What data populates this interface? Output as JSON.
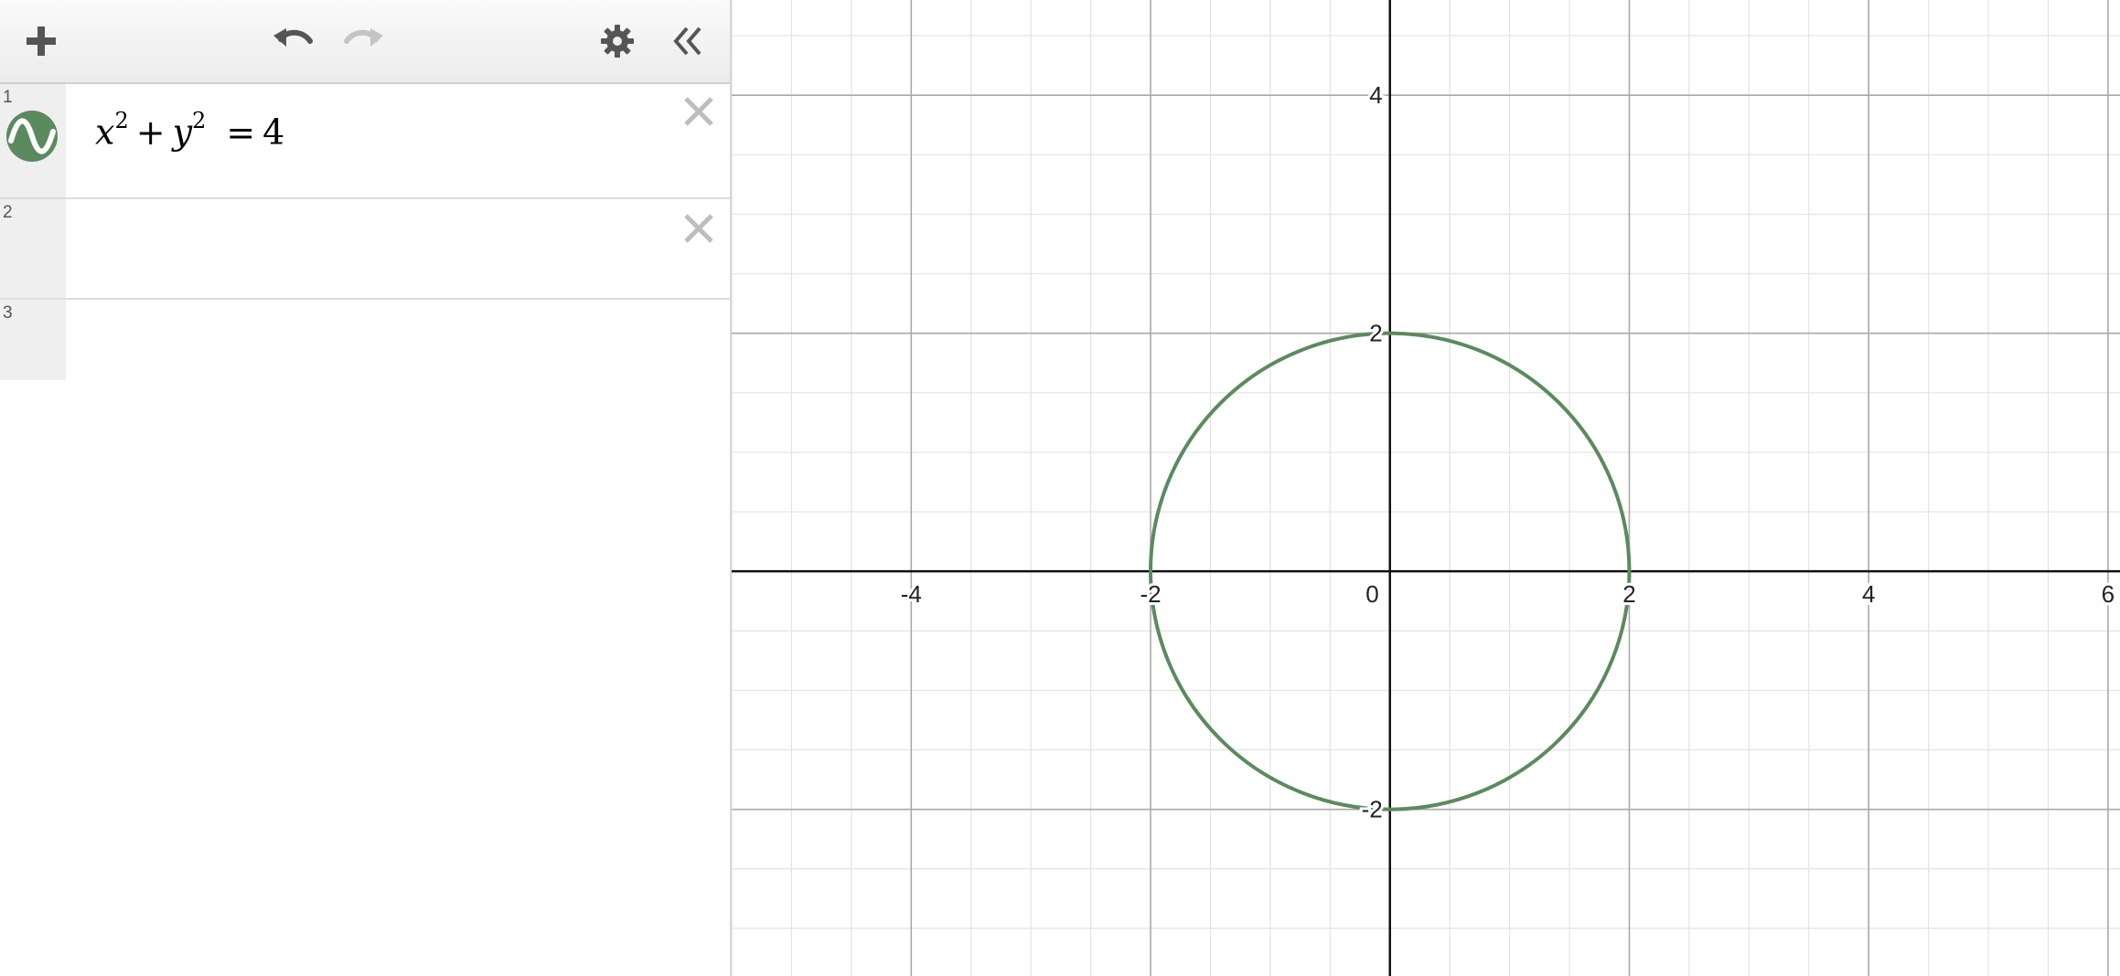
{
  "toolbar": {
    "add_icon": "plus-icon",
    "undo_icon": "undo-icon",
    "redo_icon": "redo-icon",
    "settings_icon": "gear-icon",
    "collapse_icon": "double-chevron-left-icon"
  },
  "expressions": [
    {
      "index": "1",
      "x": "x",
      "x_exp": "2",
      "plus": "+",
      "y": "y",
      "y_exp": "2",
      "equals": "=",
      "rhs": "4",
      "color": "#5b8a5e",
      "icon": "graph-style-icon"
    },
    {
      "index": "2"
    },
    {
      "index": "3"
    }
  ],
  "graph": {
    "x_range": [
      -5.5,
      6.1
    ],
    "y_range": [
      -3.4,
      4.8
    ],
    "x_ticks": [
      {
        "value": -4,
        "label": "-4"
      },
      {
        "value": -2,
        "label": "-2"
      },
      {
        "value": 2,
        "label": "2"
      },
      {
        "value": 4,
        "label": "4"
      },
      {
        "value": 6,
        "label": "6"
      }
    ],
    "y_ticks": [
      {
        "value": 4,
        "label": "4"
      },
      {
        "value": 2,
        "label": "2"
      },
      {
        "value": -2,
        "label": "-2"
      }
    ],
    "origin_label": "0",
    "curve": {
      "type": "circle",
      "center": [
        0,
        0
      ],
      "radius": 2,
      "color": "#5b8a5e"
    },
    "grid": true
  }
}
